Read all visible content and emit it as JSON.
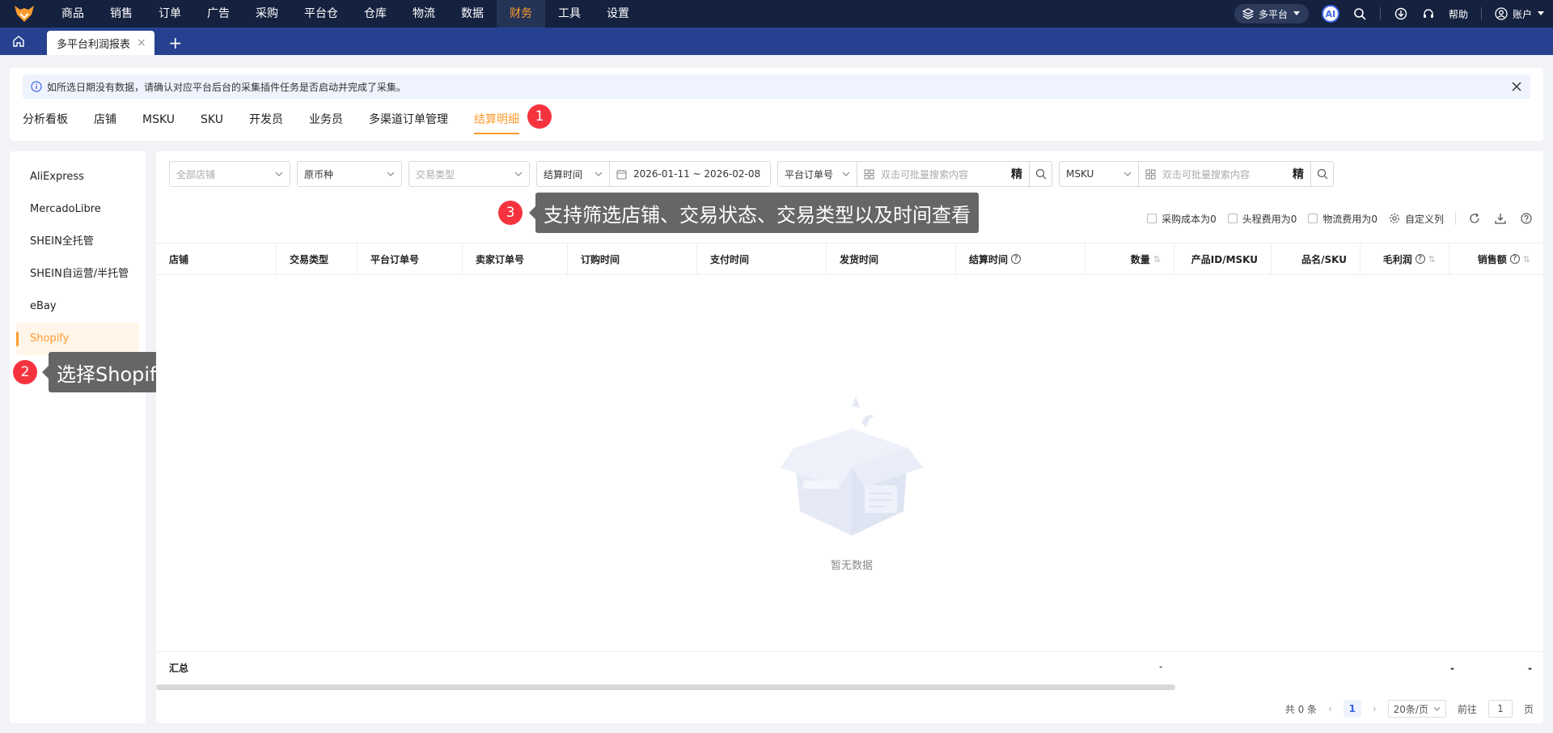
{
  "topnav": {
    "items": [
      "商品",
      "销售",
      "订单",
      "广告",
      "采购",
      "平台仓",
      "仓库",
      "物流",
      "数据",
      "财务",
      "工具",
      "设置"
    ],
    "active": "财务",
    "platform_label": "多平台",
    "ai_label": "AI",
    "help_label": "帮助",
    "account_label": "账户"
  },
  "tabbar": {
    "tab_label": "多平台利润报表",
    "close": "×",
    "add": "+"
  },
  "notice": "如所选日期没有数据，请确认对应平台后台的采集插件任务是否启动并完成了采集。",
  "subtabs": [
    "分析看板",
    "店铺",
    "MSKU",
    "SKU",
    "开发员",
    "业务员",
    "多渠道订单管理",
    "结算明细"
  ],
  "active_subtab": "结算明细",
  "badges": {
    "one": "1",
    "two": "2",
    "three": "3"
  },
  "sidebar": [
    "AliExpress",
    "MercadoLibre",
    "SHEIN全托管",
    "SHEIN自运营/半托管",
    "eBay",
    "Shopify"
  ],
  "active_side": "Shopify",
  "tooltips": {
    "side": "选择Shopify平台查看",
    "filter": "支持筛选店铺、交易状态、交易类型以及时间查看"
  },
  "filters": {
    "store": "全部店铺",
    "currency": "原币种",
    "trade_type": "交易类型",
    "time_type": "结算时间",
    "date_range": "2026-01-11 ~ 2026-02-08",
    "order_label": "平台订单号",
    "search_ph": "双击可批量搜索内容",
    "precise": "精",
    "msku_label": "MSKU",
    "search_ph2": "双击可批量搜索内容",
    "precise2": "精"
  },
  "options": {
    "cb1": "采购成本为0",
    "cb2": "头程费用为0",
    "cb3": "物流费用为0",
    "custom_cols": "自定义列"
  },
  "table": {
    "columns": [
      "店铺",
      "交易类型",
      "平台订单号",
      "卖家订单号",
      "订购时间",
      "支付时间",
      "发货时间",
      "结算时间",
      "数量",
      "产品ID/MSKU",
      "品名/SKU",
      "毛利润",
      "销售额"
    ],
    "empty_text": "暂无数据",
    "summary_label": "汇总",
    "summary_dash": "-"
  },
  "pager": {
    "total": "共 0 条",
    "page": "1",
    "page_size": "20条/页",
    "goto_prefix": "前往",
    "goto_value": "1",
    "goto_suffix": "页"
  },
  "colors": {
    "accent": "#ff9b2e",
    "nav_bg": "#14213f",
    "tab_bg": "#26418f",
    "badge": "#f5333f"
  }
}
